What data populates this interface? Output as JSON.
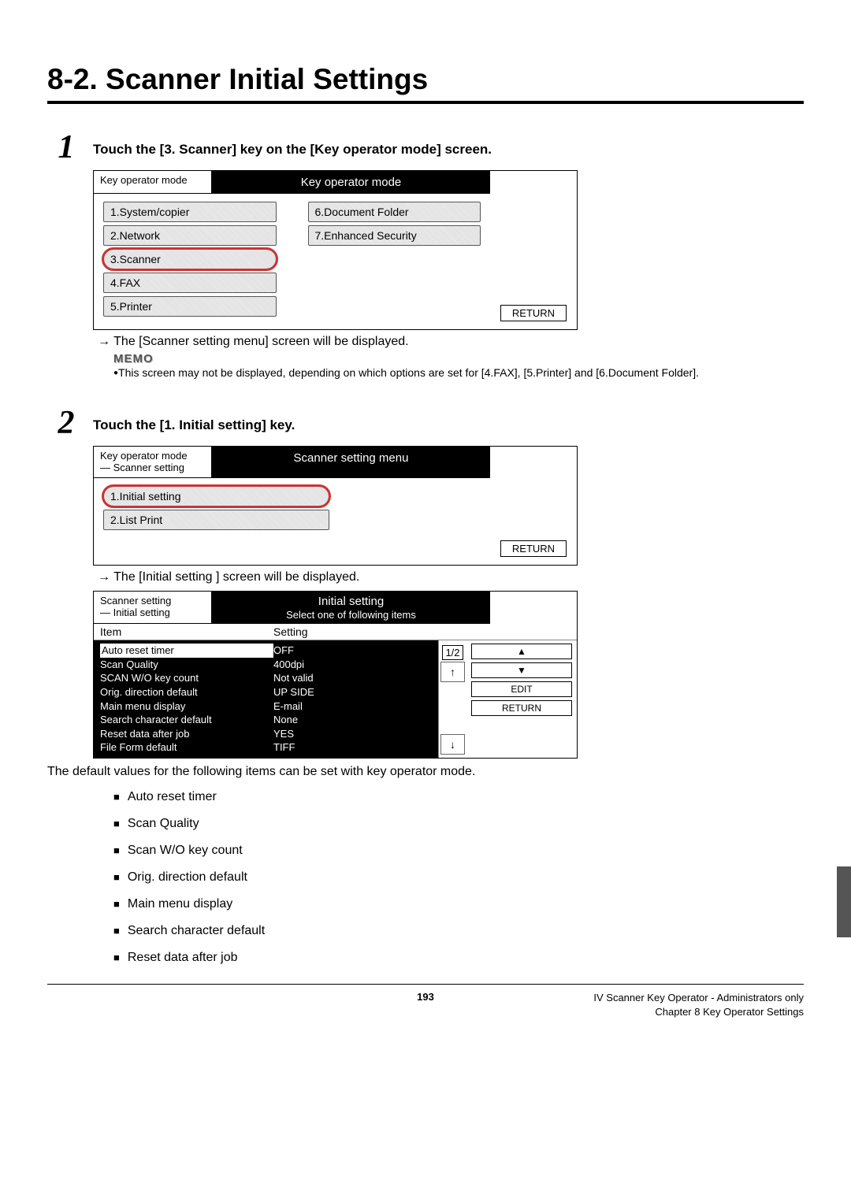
{
  "section_title": "8-2. Scanner Initial Settings",
  "steps": [
    {
      "num": "1",
      "text": "Touch the [3. Scanner] key on the [Key operator mode] screen."
    },
    {
      "num": "2",
      "text": "Touch the [1. Initial setting] key."
    }
  ],
  "screenshot1": {
    "breadcrumb": "Key operator mode",
    "title": "Key operator mode",
    "left_items": [
      "1.System/copier",
      "2.Network",
      "3.Scanner",
      "4.FAX",
      "5.Printer"
    ],
    "right_items": [
      "6.Document Folder",
      "7.Enhanced Security"
    ],
    "return": "RETURN"
  },
  "arrow1": "→ The [Scanner setting menu] screen will be displayed.",
  "memo_label": "MEMO",
  "memo_text": "This screen may not be displayed, depending on which options are set for [4.FAX], [5.Printer] and [6.Document Folder].",
  "screenshot2": {
    "breadcrumb1": "Key operator mode",
    "breadcrumb2": "— Scanner setting",
    "title": "Scanner setting menu",
    "items": [
      "1.Initial setting",
      "2.List Print"
    ],
    "return": "RETURN"
  },
  "arrow2": "→ The [Initial setting ] screen will be displayed.",
  "screenshot3": {
    "breadcrumb1": "Scanner setting",
    "breadcrumb2": "— Initial setting",
    "title": "Initial setting",
    "subtitle": "Select one of following items",
    "head_item": "Item",
    "head_setting": "Setting",
    "page": "1/2",
    "rows": [
      {
        "label": "Auto reset timer",
        "value": "OFF",
        "hl": true
      },
      {
        "label": "Scan Quality",
        "value": "400dpi"
      },
      {
        "label": "SCAN W/O key count",
        "value": "Not valid"
      },
      {
        "label": "Orig. direction default",
        "value": "UP SIDE"
      },
      {
        "label": "Main menu display",
        "value": "E-mail"
      },
      {
        "label": "Search character default",
        "value": "None"
      },
      {
        "label": "Reset data after job",
        "value": "YES"
      },
      {
        "label": "File Form default",
        "value": "TIFF"
      }
    ],
    "side_up": "⬆",
    "side_down": "⬇",
    "edit": "EDIT",
    "return": "RETURN"
  },
  "defaults_intro": "The default values for the following items can be set with key operator mode.",
  "defaults_list": [
    "Auto reset timer",
    "Scan Quality",
    "Scan W/O key count",
    "Orig. direction default",
    "Main menu display",
    "Search character default",
    "Reset data after job"
  ],
  "footer": {
    "page": "193",
    "right1": "IV Scanner Key Operator - Administrators only",
    "right2": "Chapter 8 Key Operator Settings"
  }
}
